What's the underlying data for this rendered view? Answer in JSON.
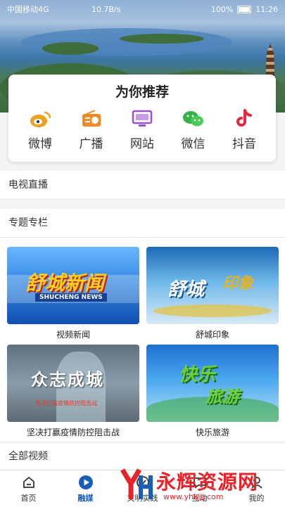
{
  "status_bar": {
    "carrier": "中国移动4G",
    "speed": "10.7B/s",
    "battery": "100%",
    "time": "11:26"
  },
  "recommend": {
    "title": "为你推荐",
    "items": [
      {
        "label": "微博",
        "icon": "weibo-icon",
        "color": "#f0a020"
      },
      {
        "label": "广播",
        "icon": "radio-icon",
        "color": "#f08a24"
      },
      {
        "label": "网站",
        "icon": "monitor-icon",
        "color": "#9b4fd6"
      },
      {
        "label": "微信",
        "icon": "wechat-icon",
        "color": "#33b544"
      },
      {
        "label": "抖音",
        "icon": "tiktok-icon",
        "color": "#e62a3e"
      }
    ]
  },
  "sections": {
    "tv_live": "电视直播",
    "special": "专题专栏",
    "all_videos": "全部视频"
  },
  "tiles": [
    {
      "caption": "视频新闻",
      "logo": "舒城新闻",
      "sub": "SHUCHENG NEWS"
    },
    {
      "caption": "舒城印象",
      "logo": "舒城",
      "sub": "印象"
    },
    {
      "caption": "坚决打赢疫情防控阻击战",
      "logo": "众志成城",
      "sub": "坚决打赢疫情防控阻击战"
    },
    {
      "caption": "快乐旅游",
      "logo": "快乐",
      "sub": "旅游"
    }
  ],
  "nav": [
    {
      "label": "首页",
      "icon": "home-icon"
    },
    {
      "label": "融媒",
      "icon": "play-circle-icon",
      "active": true
    },
    {
      "label": "文明实践",
      "icon": "practice-icon"
    },
    {
      "label": "互动",
      "icon": "chat-icon"
    },
    {
      "label": "我的",
      "icon": "user-icon"
    }
  ],
  "watermark": {
    "title": "永辉资源网",
    "url": "www.yhkjjj.com"
  },
  "colors": {
    "accent": "#1a5cb8",
    "watermark": "#e8232a"
  }
}
